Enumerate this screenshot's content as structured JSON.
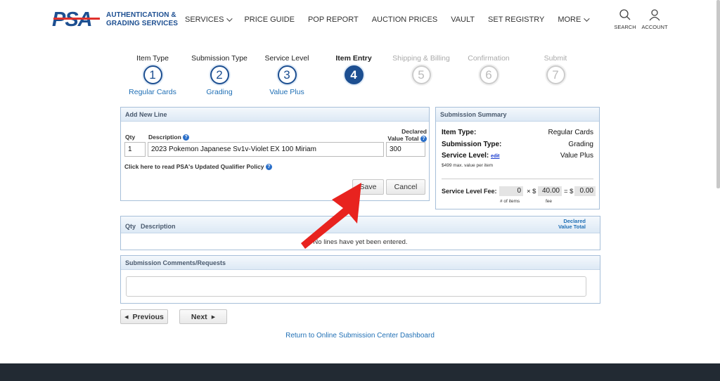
{
  "header": {
    "logo_text": "PSA",
    "brand_line1": "AUTHENTICATION &",
    "brand_line2": "GRADING SERVICES",
    "nav": [
      "SERVICES",
      "PRICE GUIDE",
      "POP REPORT",
      "AUCTION PRICES",
      "VAULT",
      "SET REGISTRY",
      "MORE"
    ],
    "search_label": "SEARCH",
    "account_label": "ACCOUNT"
  },
  "steps": [
    {
      "label": "Item Type",
      "num": "1",
      "sub": "Regular Cards"
    },
    {
      "label": "Submission Type",
      "num": "2",
      "sub": "Grading"
    },
    {
      "label": "Service Level",
      "num": "3",
      "sub": "Value Plus"
    },
    {
      "label": "Item Entry",
      "num": "4",
      "sub": ""
    },
    {
      "label": "Shipping & Billing",
      "num": "5",
      "sub": ""
    },
    {
      "label": "Confirmation",
      "num": "6",
      "sub": ""
    },
    {
      "label": "Submit",
      "num": "7",
      "sub": ""
    }
  ],
  "add_line": {
    "title": "Add New Line",
    "qty_label": "Qty",
    "desc_label": "Description",
    "declared_label_1": "Declared",
    "declared_label_2": "Value Total",
    "qty_value": "1",
    "desc_value": "2023 Pokemon Japanese Sv1v-Violet EX 100 Miriam",
    "declared_value": "300",
    "policy_link": "Click here to read PSA's Updated Qualifier Policy",
    "save": "Save",
    "cancel": "Cancel"
  },
  "summary": {
    "title": "Submission Summary",
    "item_type_label": "Item Type:",
    "item_type_value": "Regular Cards",
    "sub_type_label": "Submission Type:",
    "sub_type_value": "Grading",
    "level_label": "Service Level:",
    "level_edit": "edit",
    "level_value": "Value Plus",
    "max_value_note": "$499 max. value per item",
    "fee_label": "Service Level Fee:",
    "items_count": "0",
    "times": "× $",
    "fee": "40.00",
    "equals": "= $",
    "total": "0.00",
    "items_caption": "# of items",
    "fee_caption": "fee"
  },
  "lines": {
    "qty_header": "Qty",
    "desc_header": "Description",
    "declared_header_1": "Declared",
    "declared_header_2": "Value Total",
    "empty_message": "No lines have yet been entered."
  },
  "comments": {
    "title": "Submission Comments/Requests",
    "value": ""
  },
  "nav_buttons": {
    "previous": "Previous",
    "next": "Next"
  },
  "dashboard_link": "Return to Online Submission Center Dashboard",
  "colors": {
    "brand_blue": "#1d4f91",
    "brand_red": "#e0312c",
    "link_blue": "#1f6fb5",
    "arrow_red": "#e8231f",
    "footer": "#222a33"
  }
}
